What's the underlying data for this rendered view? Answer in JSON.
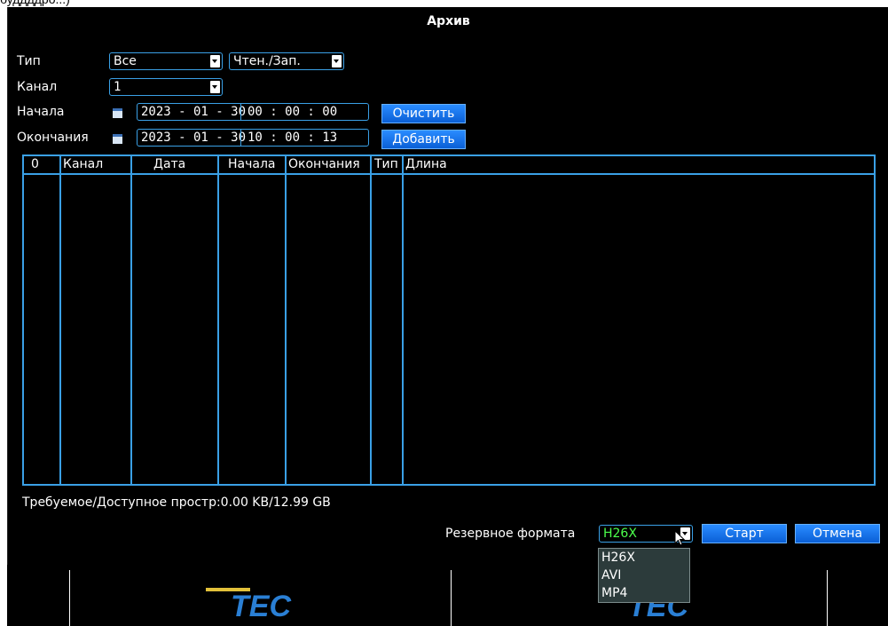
{
  "window": {
    "title": "Архив"
  },
  "filters": {
    "type_label": "Тип",
    "type_value": "Все",
    "mode_value": "Чтен./Зап.",
    "channel_label": "Канал",
    "channel_value": "1",
    "start_label": "Начала",
    "start_date": "2023 - 01 - 30",
    "start_time": "00 : 00 : 00",
    "end_label": "Окончания",
    "end_date": "2023 - 01 - 30",
    "end_time": "10 : 00 : 13",
    "clear_button": "Очистить",
    "add_button": "Добавить"
  },
  "table": {
    "columns": [
      "0",
      "Канал",
      "Дата",
      "Начала",
      "Окончания",
      "Тип",
      "Длина"
    ],
    "rows": []
  },
  "status": {
    "storage_text": "Требуемое/Доступное простр:0.00 KB/12.99 GB"
  },
  "backup": {
    "format_label": "Резервное формата",
    "format_value": "H26X",
    "format_options": [
      "H26X",
      "AVI",
      "MP4"
    ],
    "start_button": "Старт",
    "cancel_button": "Отмена"
  },
  "branding": {
    "logo_text": "TEC"
  },
  "colors": {
    "accent": "#3aa0e6",
    "button": "#0a5fd6",
    "selected_value": "#4cff4c",
    "background": "#000000"
  }
}
